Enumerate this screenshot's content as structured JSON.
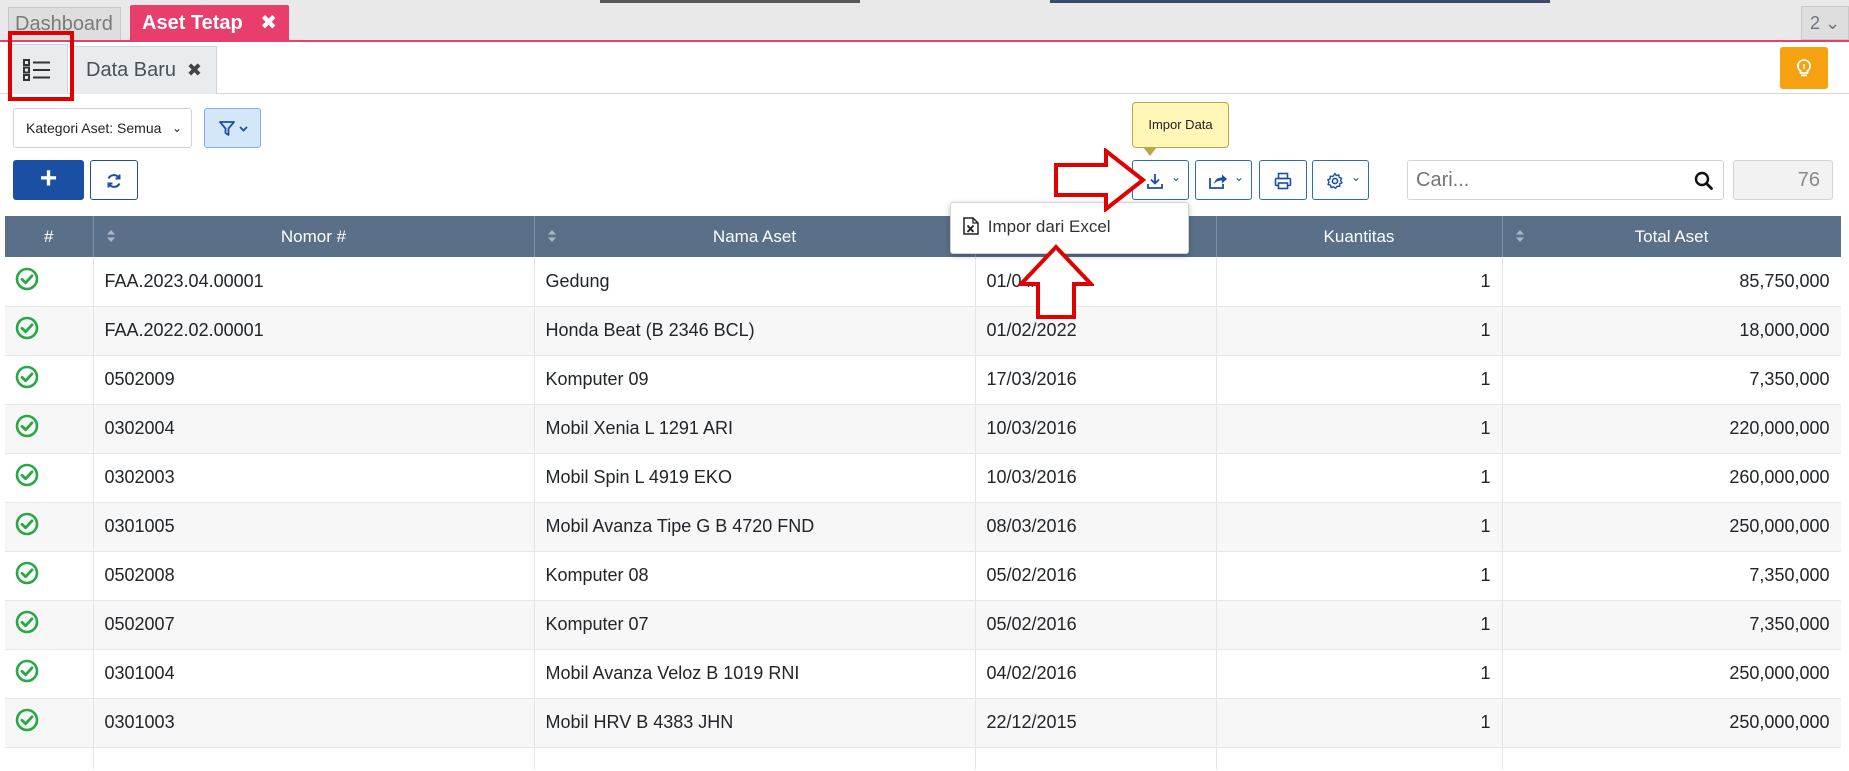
{
  "tabs": {
    "dashboard": "Dashboard",
    "active": "Aset Tetap",
    "active_close": "✖",
    "count": "2 ⌄"
  },
  "subtabs": {
    "data_baru": "Data Baru",
    "close": "✖"
  },
  "toolbar": {
    "filter_label": "Kategori Aset: Semua",
    "add_label": "+",
    "tooltip": "Impor Data",
    "search_placeholder": "Cari...",
    "count": "76"
  },
  "dropdown": {
    "item": "Impor dari Excel"
  },
  "table": {
    "headers": [
      "#",
      "Nomor #",
      "Nama Aset",
      "",
      "Kuantitas",
      "Total Aset"
    ],
    "rows": [
      {
        "nomor": "FAA.2023.04.00001",
        "nama": "Gedung",
        "tanggal": "01/04/2023",
        "qty": "1",
        "total": "85,750,000"
      },
      {
        "nomor": "FAA.2022.02.00001",
        "nama": "Honda Beat (B 2346 BCL)",
        "tanggal": "01/02/2022",
        "qty": "1",
        "total": "18,000,000"
      },
      {
        "nomor": "0502009",
        "nama": "Komputer 09",
        "tanggal": "17/03/2016",
        "qty": "1",
        "total": "7,350,000"
      },
      {
        "nomor": "0302004",
        "nama": "Mobil Xenia L 1291 ARI",
        "tanggal": "10/03/2016",
        "qty": "1",
        "total": "220,000,000"
      },
      {
        "nomor": "0302003",
        "nama": "Mobil Spin L 4919 EKO",
        "tanggal": "10/03/2016",
        "qty": "1",
        "total": "260,000,000"
      },
      {
        "nomor": "0301005",
        "nama": "Mobil Avanza Tipe G B 4720 FND",
        "tanggal": "08/03/2016",
        "qty": "1",
        "total": "250,000,000"
      },
      {
        "nomor": "0502008",
        "nama": "Komputer 08",
        "tanggal": "05/02/2016",
        "qty": "1",
        "total": "7,350,000"
      },
      {
        "nomor": "0502007",
        "nama": "Komputer 07",
        "tanggal": "05/02/2016",
        "qty": "1",
        "total": "7,350,000"
      },
      {
        "nomor": "0301004",
        "nama": "Mobil Avanza Veloz B 1019 RNI",
        "tanggal": "04/02/2016",
        "qty": "1",
        "total": "250,000,000"
      },
      {
        "nomor": "0301003",
        "nama": "Mobil HRV B 4383 JHN",
        "tanggal": "22/12/2015",
        "qty": "1",
        "total": "250,000,000"
      },
      {
        "nomor": "",
        "nama": "",
        "tanggal": "",
        "qty": "",
        "total": ""
      }
    ]
  },
  "colors": {
    "active_tab": "#e83e6c",
    "header_bg": "#5a7089",
    "primary": "#1b4fa3",
    "bulb": "#f6a10f",
    "status_ok": "#28a745",
    "annotation": "#e00000"
  }
}
